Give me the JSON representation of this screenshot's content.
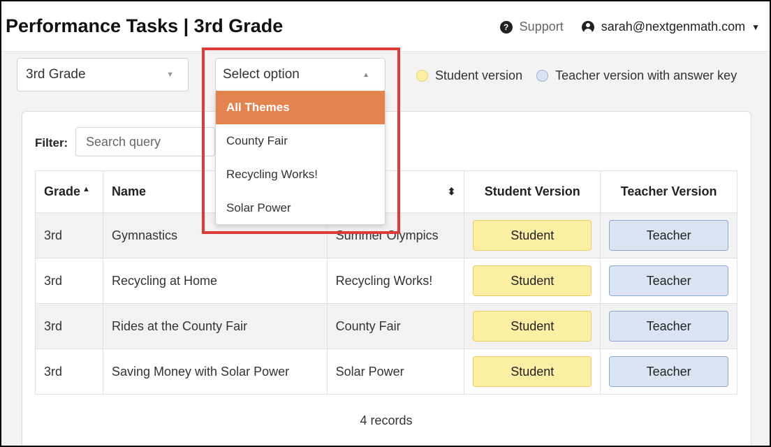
{
  "header": {
    "title": "Performance Tasks | 3rd Grade",
    "support_icon_glyph": "?",
    "support_label": "Support",
    "user_email": "sarah@nextgenmath.com",
    "user_caret_glyph": "▼"
  },
  "grade_select": {
    "value": "3rd Grade",
    "arrow_glyph": "▼"
  },
  "theme_select": {
    "placeholder": "Select option",
    "arrow_glyph": "▲",
    "options": [
      {
        "label": "All Themes",
        "selected": true
      },
      {
        "label": "County Fair",
        "selected": false
      },
      {
        "label": "Recycling Works!",
        "selected": false
      },
      {
        "label": "Solar Power",
        "selected": false
      }
    ],
    "selected_color": "#e3844e"
  },
  "legend": {
    "student_label": "Student version",
    "teacher_label": "Teacher version with answer key",
    "student_color": "#fcefa3",
    "teacher_color": "#dbe4f3"
  },
  "filter": {
    "label": "Filter:",
    "placeholder": "Search query"
  },
  "table": {
    "columns": {
      "grade": "Grade",
      "grade_sort_glyph": "▲",
      "name": "Name",
      "theme": "",
      "theme_sort_glyph": "⬍",
      "student": "Student Version",
      "teacher": "Teacher Version"
    },
    "rows": [
      {
        "grade": "3rd",
        "name": "Gymnastics",
        "theme": "Summer Olympics",
        "student_btn": "Student",
        "teacher_btn": "Teacher"
      },
      {
        "grade": "3rd",
        "name": "Recycling at Home",
        "theme": "Recycling Works!",
        "student_btn": "Student",
        "teacher_btn": "Teacher"
      },
      {
        "grade": "3rd",
        "name": "Rides at the County Fair",
        "theme": "County Fair",
        "student_btn": "Student",
        "teacher_btn": "Teacher"
      },
      {
        "grade": "3rd",
        "name": "Saving Money with Solar Power",
        "theme": "Solar Power",
        "student_btn": "Student",
        "teacher_btn": "Teacher"
      }
    ]
  },
  "footer": {
    "records_count": "4 records"
  },
  "highlight_color": "#e03b3b"
}
